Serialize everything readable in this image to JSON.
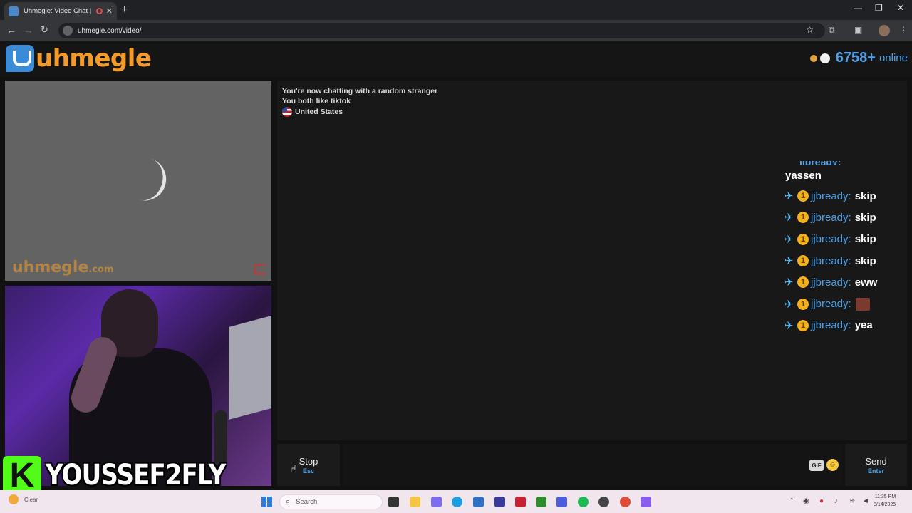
{
  "browser": {
    "tab_title": "Uhmegle: Video Chat | Ome",
    "tab_close": "✕",
    "new_tab": "+",
    "url": "uhmegle.com/video/",
    "win_minimize": "—",
    "win_restore": "❐",
    "win_close": "✕"
  },
  "site": {
    "logo_text": "uhmegle",
    "online_count": "6758+",
    "online_label": "online"
  },
  "stranger_video": {
    "watermark": "uhmegle",
    "watermark_suffix": ".com"
  },
  "streamer": {
    "badge": "K",
    "name": "YOUSSEF2FLY"
  },
  "chat": {
    "system_messages": [
      "You're now chatting with a random stranger",
      "You both like tiktok"
    ],
    "country": "United States"
  },
  "overlay_chat": {
    "top_cut": "jjbready:",
    "first_line": "yassen",
    "coin": "1",
    "sword": "✈",
    "messages": [
      {
        "user": "jjbready:",
        "text": "skip"
      },
      {
        "user": "jjbready:",
        "text": "skip"
      },
      {
        "user": "jjbready:",
        "text": "skip"
      },
      {
        "user": "jjbready:",
        "text": "skip"
      },
      {
        "user": "jjbready:",
        "text": "eww"
      },
      {
        "user": "jjbready:",
        "text": ""
      },
      {
        "user": "jjbready:",
        "text": "yea"
      }
    ]
  },
  "controls": {
    "stop_label": "Stop",
    "stop_key": "Esc",
    "gif_label": "GIF",
    "send_label": "Send",
    "send_key": "Enter"
  },
  "taskbar": {
    "weather_text": "Clear",
    "search_placeholder": "Search",
    "time": "11:35 PM",
    "date": "8/14/2025"
  },
  "colors": {
    "accent_blue": "#4ea1e8",
    "logo_orange": "#f39a2a",
    "kick_green": "#53fc18"
  }
}
